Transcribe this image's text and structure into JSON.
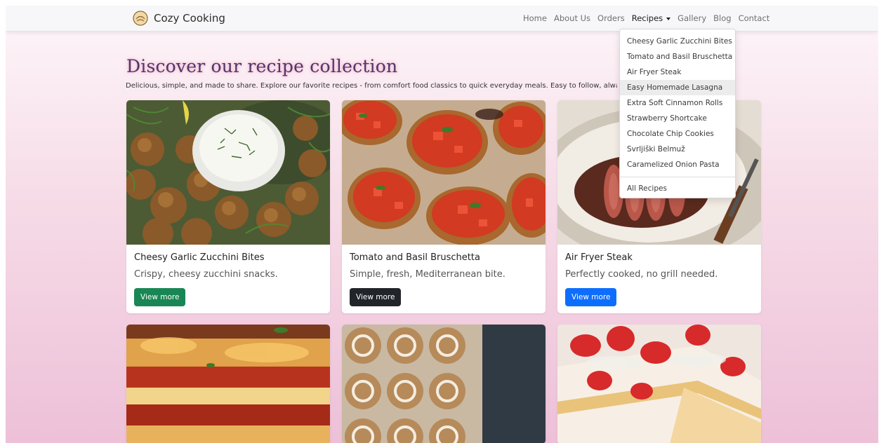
{
  "brand": {
    "name": "Cozy Cooking",
    "logo_icon": "bread-bun-icon"
  },
  "nav": {
    "items": [
      "Home",
      "About Us",
      "Orders",
      "Recipes",
      "Gallery",
      "Blog",
      "Contact"
    ],
    "active": "Recipes"
  },
  "dropdown": {
    "items": [
      "Cheesy Garlic Zucchini Bites",
      "Tomato and Basil Bruschetta",
      "Air Fryer Steak",
      "Easy Homemade Lasagna",
      "Extra Soft Cinnamon Rolls",
      "Strawberry Shortcake",
      "Chocolate Chip Cookies",
      "Svrljiški Belmuž",
      "Caramelized Onion Pasta"
    ],
    "highlighted": "Easy Homemade Lasagna",
    "all_label": "All Recipes"
  },
  "hero": {
    "title": "Discover our recipe collection",
    "subtitle": "Delicious, simple, and made to share. Explore our favorite recipes - from comfort food classics to quick everyday meals. Easy to follow, alwa"
  },
  "cards": [
    {
      "title": "Cheesy Garlic Zucchini Bites",
      "text": "Crispy, cheesy zucchini snacks.",
      "button": "View more",
      "button_color": "#198754"
    },
    {
      "title": "Tomato and Basil Bruschetta",
      "text": "Simple, fresh, Mediterranean bite.",
      "button": "View more",
      "button_color": "#212529"
    },
    {
      "title": "Air Fryer Steak",
      "text": "Perfectly cooked, no grill needed.",
      "button": "View more",
      "button_color": "#0d6efd"
    }
  ],
  "colors": {
    "navbar_bg": "#f7f7f9",
    "title": "#4a3a6a",
    "title_glow": "#f4a6c6"
  }
}
